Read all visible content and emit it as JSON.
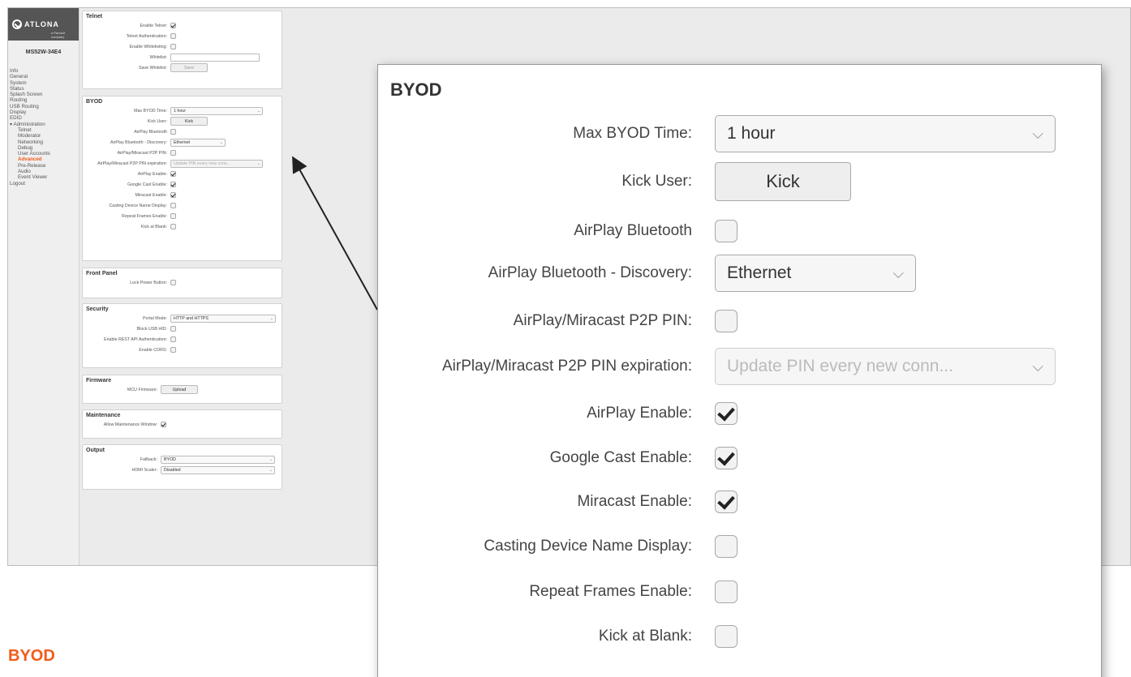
{
  "sidebar": {
    "logo_text": "ATLONA",
    "logo_sub": "a Panduit company",
    "model": "MS52W-34E4",
    "items": [
      {
        "label": "Info",
        "level": 0
      },
      {
        "label": "General",
        "level": 0
      },
      {
        "label": "System",
        "level": 0
      },
      {
        "label": "Status",
        "level": 0
      },
      {
        "label": "Splash Screen",
        "level": 0
      },
      {
        "label": "Routing",
        "level": 0
      },
      {
        "label": "USB Routing",
        "level": 0
      },
      {
        "label": "Display",
        "level": 0
      },
      {
        "label": "EDID",
        "level": 0
      },
      {
        "label": "▾ Administration",
        "level": 0
      },
      {
        "label": "Telnet",
        "level": 1
      },
      {
        "label": "Moderator",
        "level": 1
      },
      {
        "label": "Networking",
        "level": 1
      },
      {
        "label": "Debug",
        "level": 1
      },
      {
        "label": "User Accounts",
        "level": 1
      },
      {
        "label": "Advanced",
        "level": 1,
        "active": true
      },
      {
        "label": "Pre-Release",
        "level": 1
      },
      {
        "label": "Audio",
        "level": 1
      },
      {
        "label": "Event Viewer",
        "level": 1
      },
      {
        "label": "Logout",
        "level": 0
      }
    ]
  },
  "telnet": {
    "title": "Telnet",
    "enable_label": "Enable Telnet:",
    "enable": true,
    "auth_label": "Telnet Authentication:",
    "auth": false,
    "whitelisting_label": "Enable Whitelisting:",
    "whitelisting": false,
    "whitelist_label": "Whitelist:",
    "save_label": "Save Whitelist:",
    "save_button": "Save"
  },
  "byod_small": {
    "title": "BYOD",
    "max_time_label": "Max BYOD Time:",
    "max_time": "1 hour",
    "kick_user_label": "Kick User:",
    "kick_button": "Kick",
    "airplay_bt_label": "AirPlay Bluetooth",
    "airplay_bt_discovery_label": "AirPlay Bluetooth - Discovery:",
    "airplay_bt_discovery": "Ethernet",
    "p2p_pin_label": "AirPlay/Miracast P2P PIN:",
    "p2p_exp_label": "AirPlay/Miracast P2P PIN expiration:",
    "p2p_exp": "Update PIN every new conn...",
    "airplay_enable_label": "AirPlay Enable:",
    "gcast_label": "Google Cast Enable:",
    "miracast_label": "Miracast Enable:",
    "casting_name_label": "Casting Device Name Display:",
    "repeat_label": "Repeat Frames Enable:",
    "kick_blank_label": "Kick at Blank:"
  },
  "front_panel": {
    "title": "Front Panel",
    "lock_label": "Lock Power Button:"
  },
  "security": {
    "title": "Security",
    "portal_label": "Portal Mode:",
    "portal": "HTTP and HTTPS",
    "block_usb_label": "Block USB HID:",
    "rest_label": "Enable REST API Authentication:",
    "cors_label": "Enable CORS:"
  },
  "firmware": {
    "title": "Firmware",
    "mcu_label": "MCU Firmware:",
    "upload_button": "Upload"
  },
  "maintenance": {
    "title": "Maintenance",
    "allow_label": "Allow Maintenance Window:"
  },
  "output": {
    "title": "Output",
    "fallback_label": "Fallback:",
    "fallback": "BYOD",
    "scaler_label": "HDMI Scaler:",
    "scaler": "Disabled"
  },
  "zoom": {
    "title": "BYOD",
    "max_time_label": "Max BYOD Time:",
    "max_time": "1 hour",
    "kick_user_label": "Kick User:",
    "kick_button": "Kick",
    "airplay_bt_label": "AirPlay Bluetooth",
    "airplay_bt": false,
    "airplay_bt_discovery_label": "AirPlay Bluetooth - Discovery:",
    "airplay_bt_discovery": "Ethernet",
    "p2p_pin_label": "AirPlay/Miracast P2P PIN:",
    "p2p_pin": false,
    "p2p_exp_label": "AirPlay/Miracast P2P PIN expiration:",
    "p2p_exp": "Update PIN every new conn...",
    "airplay_enable_label": "AirPlay Enable:",
    "airplay_enable": true,
    "gcast_label": "Google Cast Enable:",
    "gcast": true,
    "miracast_label": "Miracast Enable:",
    "miracast": true,
    "casting_name_label": "Casting Device Name Display:",
    "casting_name": false,
    "repeat_label": "Repeat Frames Enable:",
    "repeat": false,
    "kick_blank_label": "Kick at Blank:",
    "kick_blank": false
  },
  "icons": {
    "chevron": "chevron-down-icon",
    "check": "checkmark-icon",
    "logo": "atlona-logo-icon"
  },
  "colors": {
    "accent": "#f25c19",
    "sidebar_bg": "#efefef",
    "logo_bg": "#555555"
  },
  "caption": "BYOD"
}
